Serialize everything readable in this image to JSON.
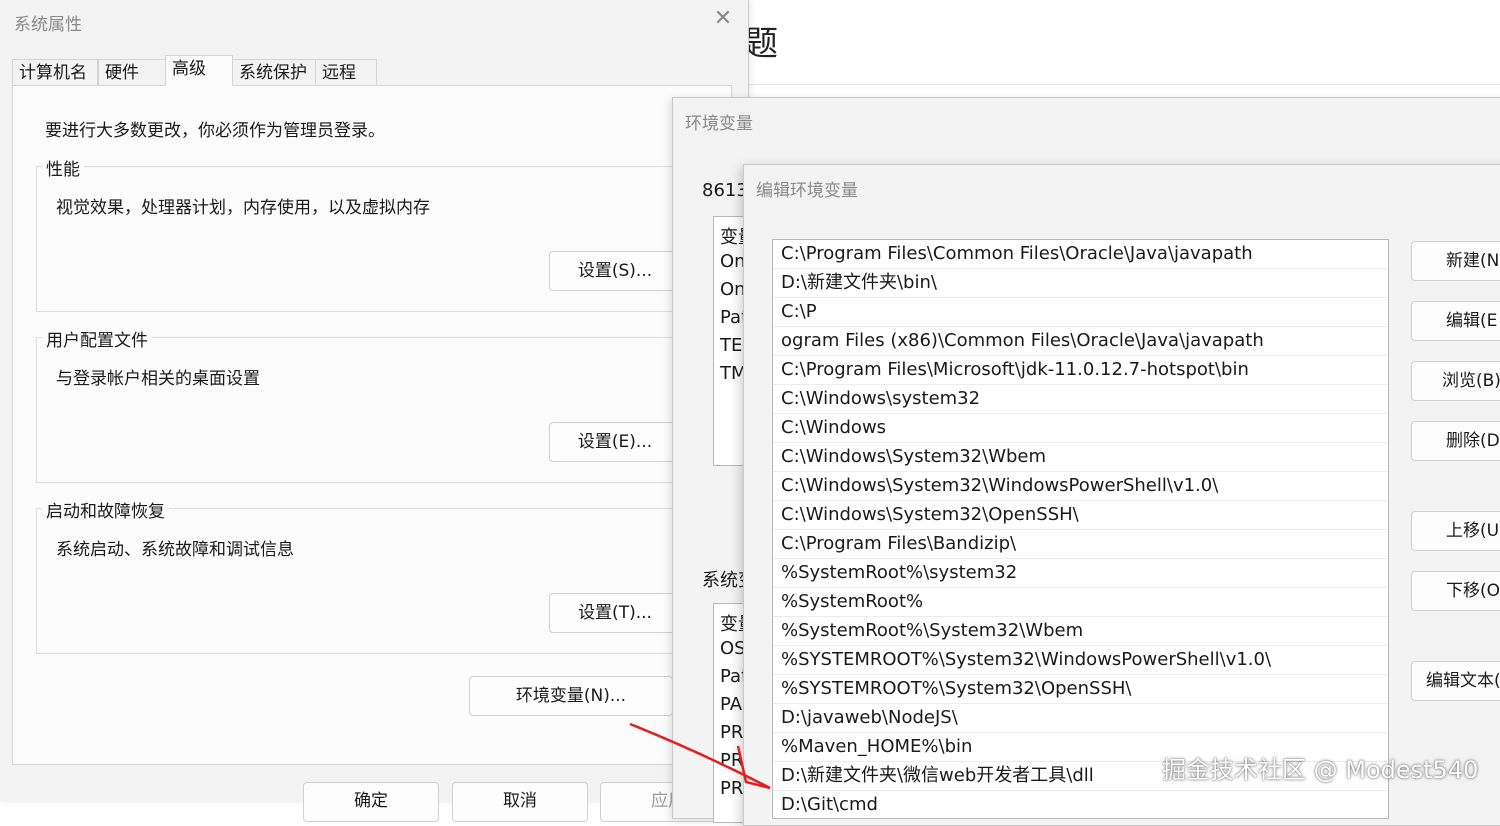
{
  "background": {
    "heading_char": "题"
  },
  "system_properties": {
    "title": "系统属性",
    "tabs": [
      "计算机名",
      "硬件",
      "高级",
      "系统保护",
      "远程"
    ],
    "active_tab": "高级",
    "admin_note": "要进行大多数更改，你必须作为管理员登录。",
    "performance": {
      "label": "性能",
      "desc": "视觉效果，处理器计划，内存使用，以及虚拟内存",
      "button": "设置(S)..."
    },
    "user_profiles": {
      "label": "用户配置文件",
      "desc": "与登录帐户相关的桌面设置",
      "button": "设置(E)..."
    },
    "startup_recovery": {
      "label": "启动和故障恢复",
      "desc": "系统启动、系统故障和调试信息",
      "button": "设置(T)..."
    },
    "env_button": "环境变量(N)...",
    "ok": "确定",
    "cancel": "取消",
    "apply": "应用"
  },
  "environment_variables": {
    "title": "环境变量",
    "user_section_label": "8613",
    "user_list": [
      "变量",
      "On",
      "On",
      "Pat",
      "TEI",
      "TM"
    ],
    "system_section_label": "系统变",
    "system_list": [
      "变量",
      "OS",
      "Pat",
      "PA",
      "PR",
      "PR",
      "PR"
    ]
  },
  "edit_env": {
    "title": "编辑环境变量",
    "paths": [
      "C:\\Program Files\\Common Files\\Oracle\\Java\\javapath",
      "D:\\新建文件夹\\bin\\",
      "C:\\P",
      "ogram Files (x86)\\Common Files\\Oracle\\Java\\javapath",
      "C:\\Program Files\\Microsoft\\jdk-11.0.12.7-hotspot\\bin",
      "C:\\Windows\\system32",
      "C:\\Windows",
      "C:\\Windows\\System32\\Wbem",
      "C:\\Windows\\System32\\WindowsPowerShell\\v1.0\\",
      "C:\\Windows\\System32\\OpenSSH\\",
      "C:\\Program Files\\Bandizip\\",
      "%SystemRoot%\\system32",
      "%SystemRoot%",
      "%SystemRoot%\\System32\\Wbem",
      "%SYSTEMROOT%\\System32\\WindowsPowerShell\\v1.0\\",
      "%SYSTEMROOT%\\System32\\OpenSSH\\",
      "D:\\javaweb\\NodeJS\\",
      "%Maven_HOME%\\bin",
      "D:\\新建文件夹\\微信web开发者工具\\dll",
      "D:\\Git\\cmd"
    ],
    "buttons": {
      "new": "新建(N",
      "edit": "编辑(E",
      "browse": "浏览(B)",
      "delete": "删除(D",
      "move_up": "上移(U",
      "move_down": "下移(O",
      "edit_text": "编辑文本("
    }
  },
  "watermark": "掘金技术社区 @ Modest540",
  "colors": {
    "annotation_arrow": "#e02020",
    "dialog_bg": "#f3f3f3"
  }
}
